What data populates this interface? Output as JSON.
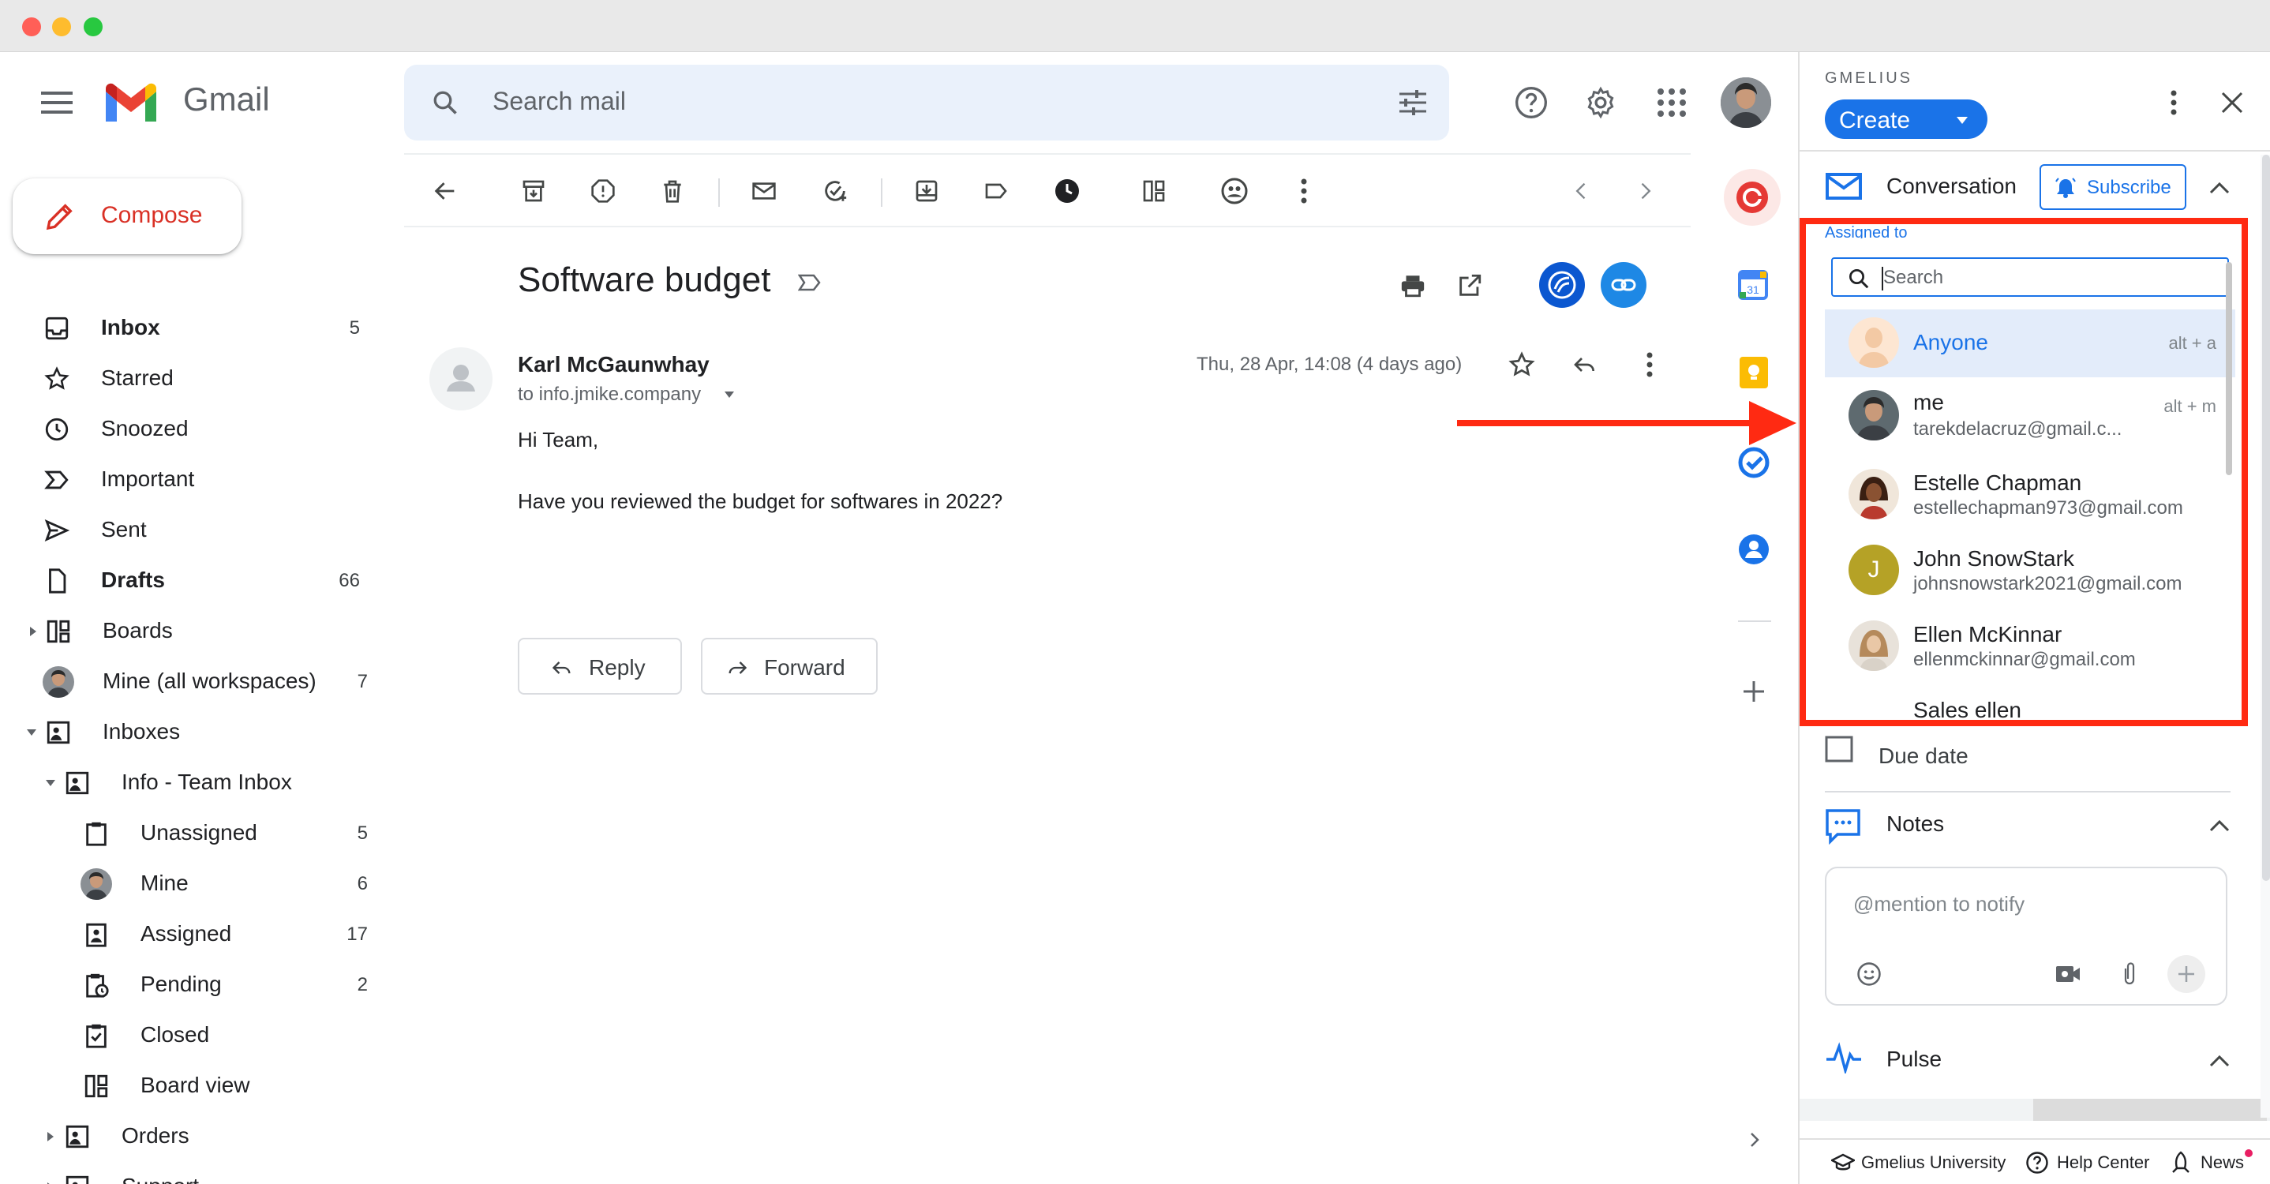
{
  "app": {
    "name": "Gmail"
  },
  "search": {
    "placeholder": "Search mail"
  },
  "compose": {
    "label": "Compose"
  },
  "sidebar": {
    "items": [
      {
        "label": "Inbox",
        "count": "5"
      },
      {
        "label": "Starred",
        "count": ""
      },
      {
        "label": "Snoozed",
        "count": ""
      },
      {
        "label": "Important",
        "count": ""
      },
      {
        "label": "Sent",
        "count": ""
      },
      {
        "label": "Drafts",
        "count": "66"
      },
      {
        "label": "Boards",
        "count": ""
      },
      {
        "label": "Mine (all workspaces)",
        "count": "7"
      },
      {
        "label": "Inboxes",
        "count": ""
      },
      {
        "label": "Info - Team Inbox",
        "count": ""
      },
      {
        "label": "Unassigned",
        "count": "5"
      },
      {
        "label": "Mine",
        "count": "6"
      },
      {
        "label": "Assigned",
        "count": "17"
      },
      {
        "label": "Pending",
        "count": "2"
      },
      {
        "label": "Closed",
        "count": ""
      },
      {
        "label": "Board view",
        "count": ""
      },
      {
        "label": "Orders",
        "count": ""
      },
      {
        "label": "Support",
        "count": ""
      }
    ]
  },
  "email": {
    "subject": "Software budget",
    "sender": "Karl McGaunwhay",
    "to": "to info.jmike.company",
    "date": "Thu, 28 Apr, 14:08 (4 days ago)",
    "body_line1": "Hi Team,",
    "body_line2": "Have you reviewed the budget for softwares in 2022?",
    "reply_label": "Reply",
    "forward_label": "Forward"
  },
  "gmelius": {
    "brand": "GMELIUS",
    "create_label": "Create",
    "conversation_label": "Conversation",
    "subscribe_label": "Subscribe",
    "assigned_to_label": "Assigned to",
    "search_placeholder": "Search",
    "due_date_label": "Due date",
    "notes_label": "Notes",
    "notes_placeholder": "@mention to notify",
    "pulse_label": "Pulse",
    "footer": {
      "university": "Gmelius University",
      "help": "Help Center",
      "news": "News"
    }
  },
  "assignees": [
    {
      "name": "Anyone",
      "email": "",
      "shortcut": "alt + a"
    },
    {
      "name": "me",
      "email": "tarekdelacruz@gmail.c...",
      "shortcut": "alt + m"
    },
    {
      "name": "Estelle Chapman",
      "email": "estellechapman973@gmail.com",
      "shortcut": ""
    },
    {
      "name": "John SnowStark",
      "email": "johnsnowstark2021@gmail.com",
      "shortcut": "",
      "initial": "J"
    },
    {
      "name": "Ellen McKinnar",
      "email": "ellenmckinnar@gmail.com",
      "shortcut": ""
    },
    {
      "name": "Sales ellen",
      "email": "",
      "shortcut": ""
    }
  ],
  "colors": {
    "accent": "#1a73e8",
    "gmail_red": "#d93025",
    "annotation_red": "#ff2a12"
  }
}
